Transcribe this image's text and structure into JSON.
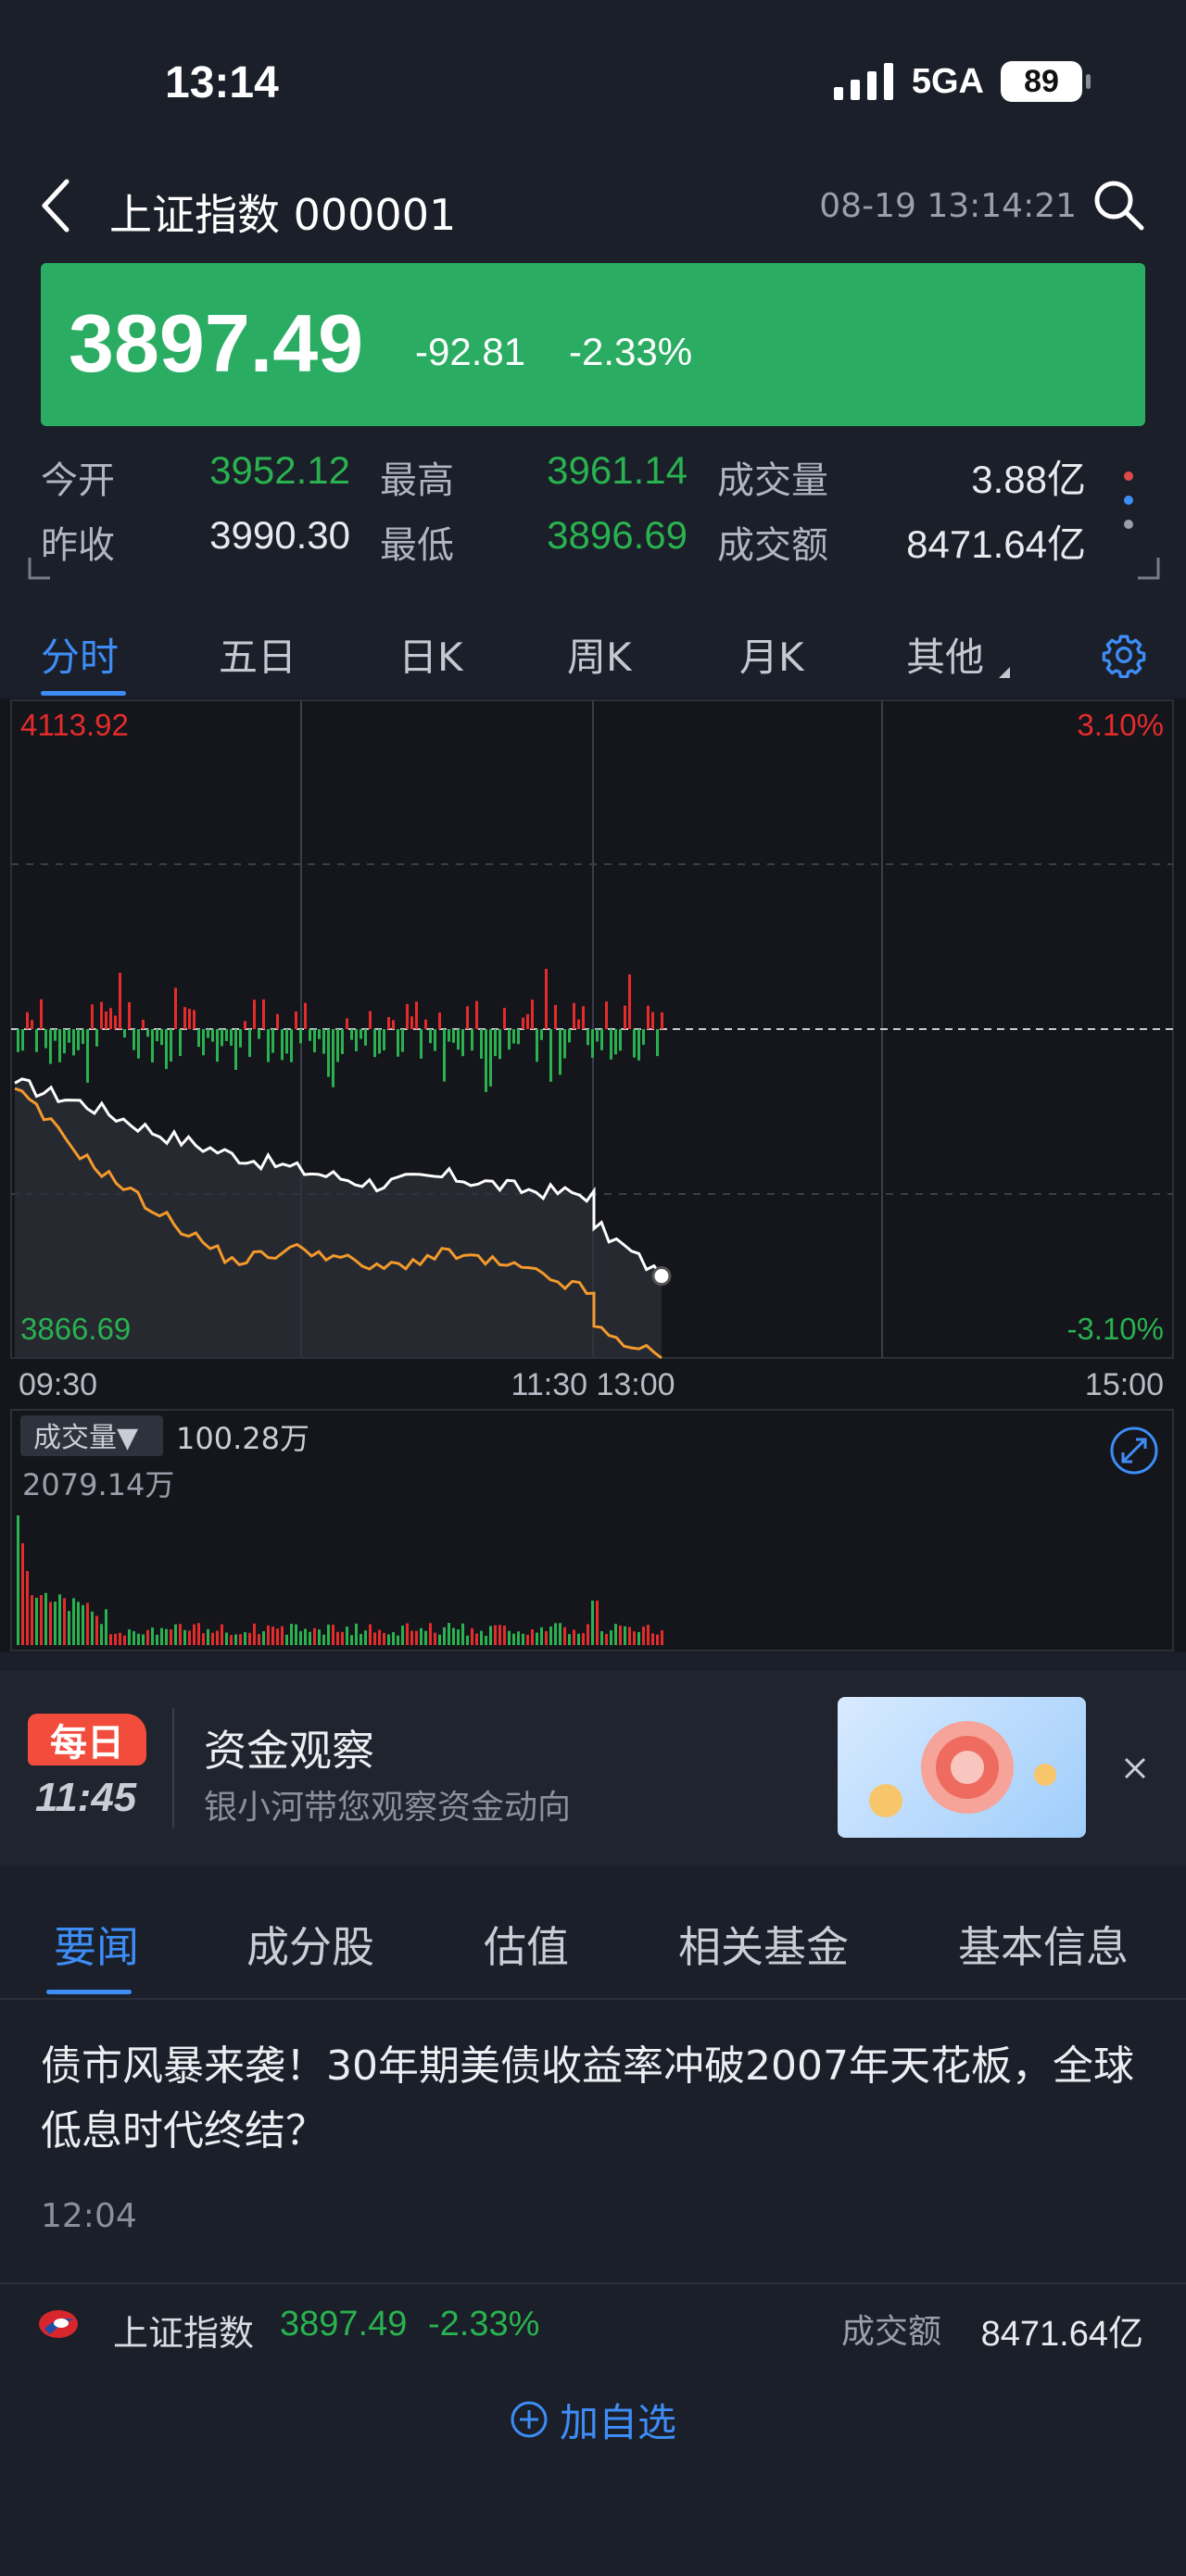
{
  "status": {
    "time": "13:14",
    "network": "5GA",
    "battery": "89"
  },
  "header": {
    "title": "上证指数 000001",
    "datetime": "08-19 13:14:21"
  },
  "quote": {
    "price": "3897.49",
    "change": "-92.81",
    "change_pct": "-2.33%"
  },
  "stats": [
    {
      "label": "今开",
      "value": "3952.12",
      "tone": "green"
    },
    {
      "label": "最高",
      "value": "3961.14",
      "tone": "green"
    },
    {
      "label": "成交量",
      "value": "3.88亿",
      "tone": "white"
    },
    {
      "label": "昨收",
      "value": "3990.30",
      "tone": "white"
    },
    {
      "label": "最低",
      "value": "3896.69",
      "tone": "green"
    },
    {
      "label": "成交额",
      "value": "8471.64亿",
      "tone": "white"
    }
  ],
  "chart_tabs": [
    "分时",
    "五日",
    "日K",
    "周K",
    "月K",
    "其他"
  ],
  "chart": {
    "price_high": "4113.92",
    "price_low": "3866.69",
    "pct_high": "3.10%",
    "pct_low": "-3.10%",
    "time_labels": [
      "09:30",
      "11:30 13:00",
      "15:00"
    ],
    "volume_selector": "成交量▼",
    "volume_current": "100.28万",
    "volume_max": "2079.14万"
  },
  "chart_data": {
    "type": "line",
    "title": "",
    "xlabel": "",
    "ylabel": "",
    "ylim": [
      3866.69,
      4113.92
    ],
    "y2lim": [
      "-3.10%",
      "3.10%"
    ],
    "reference": 3990.3,
    "grid": true,
    "x": [
      "09:30",
      "09:45",
      "10:00",
      "10:15",
      "10:30",
      "10:45",
      "11:00",
      "11:15",
      "11:30",
      "13:00",
      "13:14"
    ],
    "series": [
      {
        "values": [
          3970,
          3962,
          3951,
          3943,
          3937,
          3932,
          3935,
          3930,
          3928,
          3917,
          3897.49
        ]
      },
      {
        "values": [
          3968,
          3941,
          3921,
          3903,
          3908,
          3900,
          3906,
          3900,
          3891,
          3878,
          3866.69
        ]
      }
    ]
  },
  "promo": {
    "badge_top": "每日",
    "badge_time": "11:45",
    "title": "资金观察",
    "subtitle": "银小河带您观察资金动向"
  },
  "news_tabs": [
    "要闻",
    "成分股",
    "估值",
    "相关基金",
    "基本信息"
  ],
  "news": {
    "title": " 债市风暴来袭！30年期美债收益率冲破2007年天花板，全球低息时代终结？",
    "time": "12:04"
  },
  "quote_row": {
    "name": "上证指数",
    "price": "3897.49",
    "pct": "-2.33%",
    "amount_label": "成交额",
    "amount": "8471.64亿"
  },
  "add_label": "加自选",
  "colors": {
    "up": "#e62b2b",
    "down": "#29b24f",
    "accent": "#3e8df7",
    "banner": "#2aad63"
  }
}
